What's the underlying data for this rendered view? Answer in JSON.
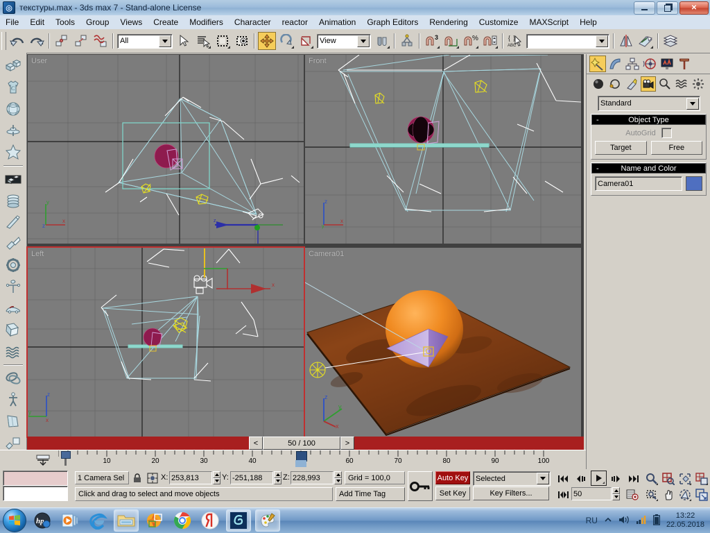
{
  "window": {
    "title": "текстуры.max - 3ds max 7  - Stand-alone License",
    "app_icon": "3dsmax-icon",
    "minimize": "minimize-icon",
    "restore": "restore-icon",
    "close": "✕"
  },
  "menu": {
    "items": [
      "File",
      "Edit",
      "Tools",
      "Group",
      "Views",
      "Create",
      "Modifiers",
      "Character",
      "reactor",
      "Animation",
      "Graph Editors",
      "Rendering",
      "Customize",
      "MAXScript",
      "Help"
    ]
  },
  "toolbar": {
    "undo": "undo-icon",
    "redo": "redo-icon",
    "select_link": "select-and-link-icon",
    "unlink": "unlink-selection-icon",
    "bind_space_warp": "bind-to-space-warp-icon",
    "selection_filter": "All",
    "select_object": "select-object-icon",
    "select_by_name": "select-by-name-icon",
    "select_region": "rectangular-selection-region-icon",
    "window_crossing": "window-crossing-icon",
    "select_move": "select-and-move-icon",
    "select_rotate": "select-and-rotate-icon",
    "select_scale": "select-and-scale-icon",
    "reference_coordinate_system": "View",
    "use_pivot": "use-pivot-point-center-icon",
    "mirror": "mirror-icon",
    "align": "align-icon",
    "snap_toggle": "snap-toggle-3-icon",
    "angle_snap": "angle-snap-toggle-icon",
    "percent_snap": "percent-snap-toggle-icon",
    "spinner_snap": "spinner-snap-toggle-icon",
    "named_selection_sets": "named-selection-sets-icon",
    "named_set_value": "",
    "mirror2": "mirror-selected-objects-icon",
    "align2": "align-icon",
    "layers": "layer-manager-icon"
  },
  "left_toolbar": {
    "items": [
      "box-primitives-icon",
      "cloth-garment-icon",
      "sphere-icon",
      "spinning-top-icon",
      "star-shape-icon",
      "bevel-box-icon",
      "coil-spring-icon",
      "chisel-icon",
      "bend-icon",
      "gear-icon",
      "weathervane-icon",
      "car-icon",
      "folded-plane-icon",
      "waves-icon",
      "torus-knot-icon",
      "biped-figure-icon",
      "plane-fold-icon",
      "objects-icon"
    ]
  },
  "viewports": [
    {
      "name": "User",
      "label": "User",
      "active": false
    },
    {
      "name": "Front",
      "label": "Front",
      "active": false
    },
    {
      "name": "Left",
      "label": "Left",
      "active": true
    },
    {
      "name": "Camera01",
      "label": "Camera01",
      "active": false
    }
  ],
  "time_slider": {
    "value": "50 / 100",
    "prev": "<",
    "next": ">"
  },
  "track_ruler": {
    "labels": [
      "10",
      "20",
      "30",
      "40",
      "50",
      "60",
      "70",
      "80",
      "90",
      "100"
    ],
    "current_frame": 50,
    "total_frames": 100
  },
  "status": {
    "selection": "1 Camera Sel",
    "lock_icon": "selection-lock-icon",
    "transform_type_in_icon": "absolute-mode-transform-type-in-icon",
    "x_label": "X:",
    "x_value": "253,813",
    "y_label": "Y:",
    "y_value": "-251,188",
    "z_label": "Z:",
    "z_value": "228,993",
    "grid": "Grid = 100,0",
    "prompt": "Click and drag to select and move objects",
    "add_time_tag": "Add Time Tag"
  },
  "animation": {
    "key_mode_icon": "set-key-mode-icon",
    "auto_key": "Auto Key",
    "set_key": "Set Key",
    "key_filter_selection": "Selected",
    "key_filters": "Key Filters...",
    "go_to_start": "go-to-start-icon",
    "previous_frame": "previous-frame-icon",
    "play": "play-animation-icon",
    "next_frame": "next-frame-icon",
    "go_to_end": "go-to-end-icon",
    "key_mode_toggle": "key-mode-toggle-icon",
    "current_frame": "50",
    "time_configuration": "time-configuration-icon"
  },
  "viewport_nav": {
    "zoom": "zoom-icon",
    "zoom_all": "zoom-all-icon",
    "zoom_extents": "zoom-extents-icon",
    "zoom_extents_all": "zoom-extents-all-icon",
    "field_of_view": "field-of-view-icon",
    "pan": "pan-view-icon",
    "arc_rotate": "arc-rotate-icon",
    "maximize_viewport": "maximize-viewport-toggle-icon"
  },
  "command_panel": {
    "tabs": [
      {
        "name": "create",
        "icon": "create-tab-icon",
        "active": true
      },
      {
        "name": "modify",
        "icon": "modify-tab-icon",
        "active": false
      },
      {
        "name": "hierarchy",
        "icon": "hierarchy-tab-icon",
        "active": false
      },
      {
        "name": "motion",
        "icon": "motion-tab-icon",
        "active": false
      },
      {
        "name": "display",
        "icon": "display-tab-icon",
        "active": false
      },
      {
        "name": "utilities",
        "icon": "utilities-tab-icon",
        "active": false
      }
    ],
    "category_buttons": [
      {
        "name": "geometry",
        "icon": "geometry-icon",
        "active": false
      },
      {
        "name": "shapes",
        "icon": "shapes-icon",
        "active": false
      },
      {
        "name": "lights",
        "icon": "lights-icon",
        "active": false
      },
      {
        "name": "cameras",
        "icon": "cameras-icon",
        "active": true
      },
      {
        "name": "helpers",
        "icon": "helpers-icon",
        "active": false
      },
      {
        "name": "space-warps",
        "icon": "space-warps-icon",
        "active": false
      },
      {
        "name": "systems",
        "icon": "systems-icon",
        "active": false
      }
    ],
    "subcategory": "Standard",
    "object_type": {
      "header": "Object Type",
      "collapse": "-",
      "autogrid_label": "AutoGrid",
      "autogrid_checked": false,
      "buttons": [
        "Target",
        "Free"
      ]
    },
    "name_and_color": {
      "header": "Name and Color",
      "collapse": "-",
      "name": "Camera01",
      "color": "#4f6fc0"
    }
  },
  "taskbar": {
    "start": "windows-start-icon",
    "items": [
      "hp-support-icon",
      "media-player-icon",
      "internet-explorer-icon",
      "windows-explorer-icon",
      "photo-editor-icon",
      "google-chrome-icon",
      "yandex-browser-icon",
      "3dsmax-icon",
      "paint-palette-icon"
    ],
    "language": "RU",
    "show_hidden": "show-hidden-icons-icon",
    "volume": "volume-icon",
    "network": "network-icon",
    "battery": "battery-icon",
    "time": "13:22",
    "date": "22.05.2018"
  },
  "colors": {
    "viewport_bg": "#7c7c7c",
    "active_viewport_border": "#c03030",
    "accent_yellow": "#f6cd5a",
    "auto_key_red": "#a00f0f",
    "camera_cyan": "#a8d8e0",
    "sphere_magenta": "#8e1b4e",
    "light_yellow": "#e8e020",
    "plane_orange": "#b4601e"
  }
}
